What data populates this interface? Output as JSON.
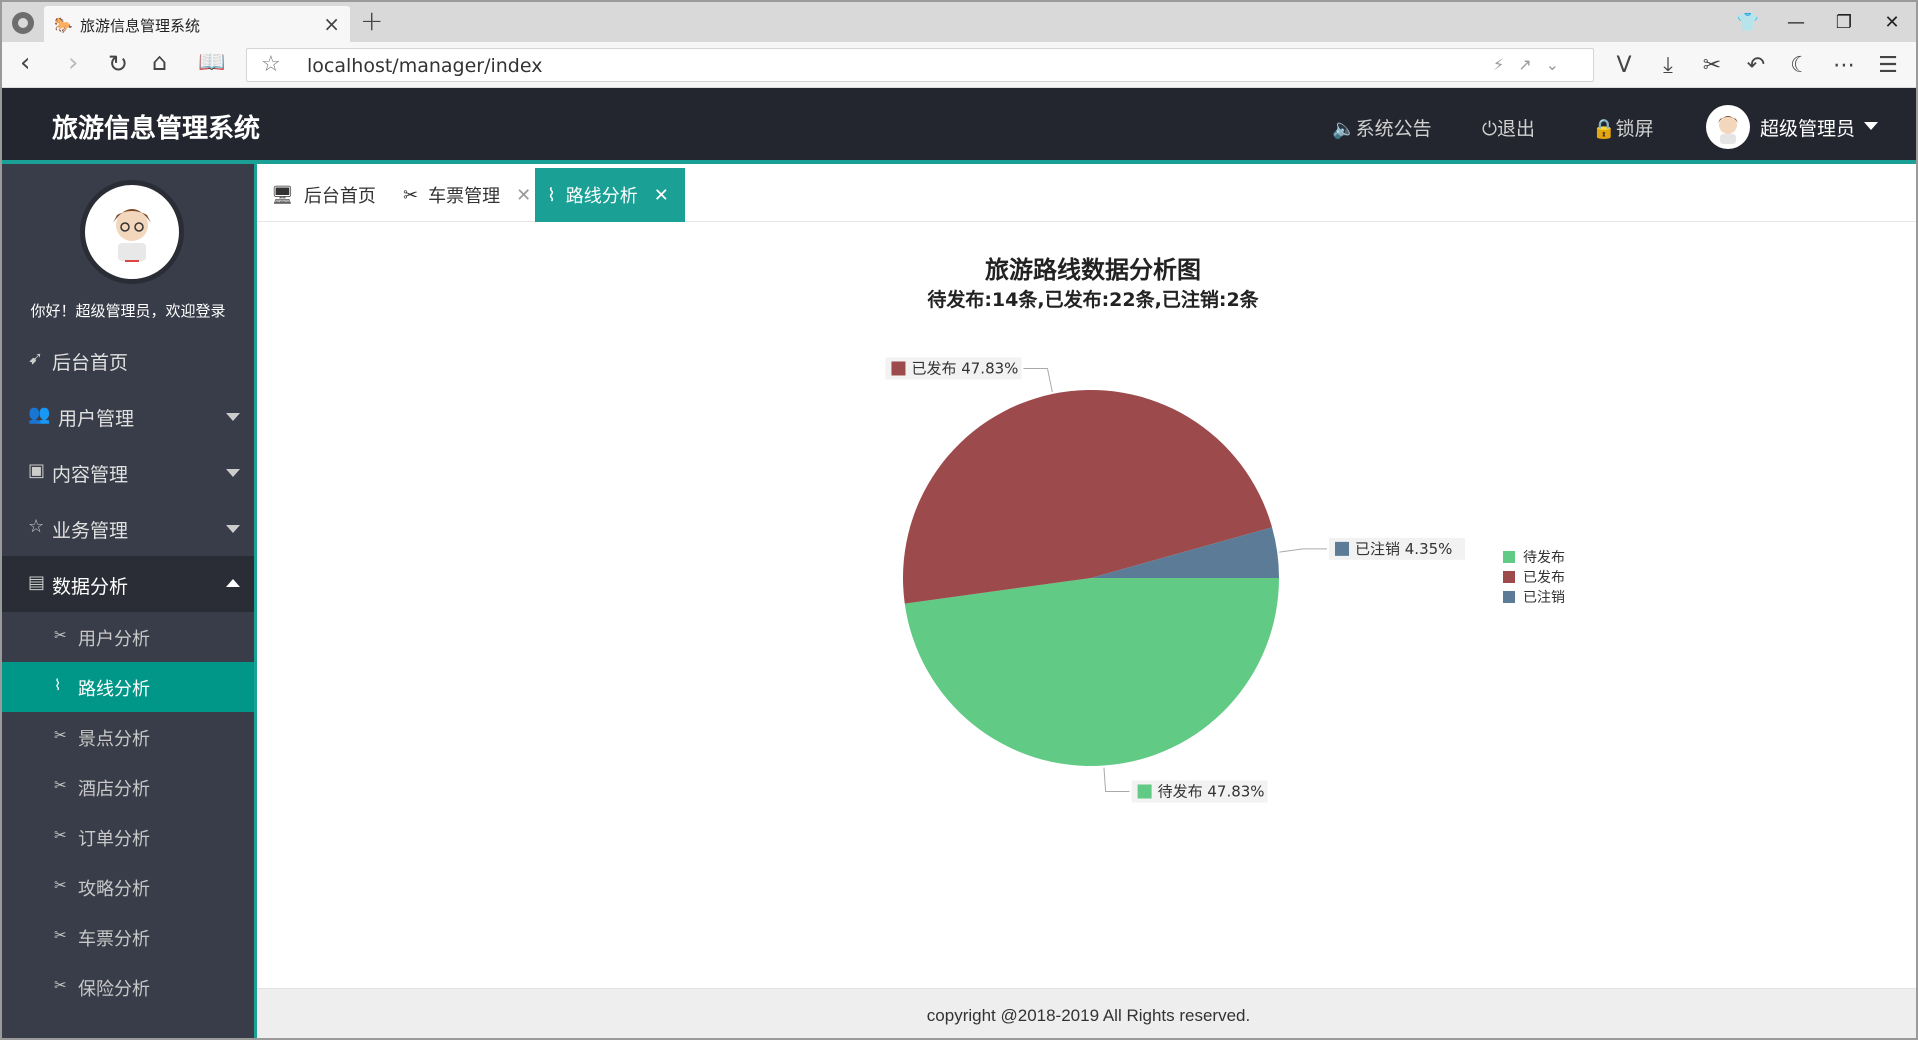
{
  "browser": {
    "tab_title": "旅游信息管理系统",
    "url": "localhost/manager/index",
    "favicon": "horse-icon",
    "new_tab": "+"
  },
  "header": {
    "title": "旅游信息管理系统",
    "notice": "系统公告",
    "logout": "退出",
    "lock": "锁屏",
    "user": "超级管理员"
  },
  "sidebar": {
    "greeting": "你好！超级管理员，欢迎登录",
    "items": [
      {
        "label": "后台首页",
        "icon": "paper-plane-icon"
      },
      {
        "label": "用户管理",
        "icon": "users-icon"
      },
      {
        "label": "内容管理",
        "icon": "image-icon"
      },
      {
        "label": "业务管理",
        "icon": "star-icon"
      },
      {
        "label": "数据分析",
        "icon": "chart-icon"
      }
    ],
    "sub_items": [
      {
        "label": "用户分析"
      },
      {
        "label": "路线分析"
      },
      {
        "label": "景点分析"
      },
      {
        "label": "酒店分析"
      },
      {
        "label": "订单分析"
      },
      {
        "label": "攻略分析"
      },
      {
        "label": "车票分析"
      },
      {
        "label": "保险分析"
      }
    ]
  },
  "tabs": [
    {
      "label": "后台首页",
      "icon": "monitor-icon"
    },
    {
      "label": "车票管理",
      "icon": "tools-icon"
    },
    {
      "label": "路线分析",
      "icon": "pulse-icon"
    }
  ],
  "chart_data": {
    "type": "pie",
    "title": "旅游路线数据分析图",
    "subtitle": "待发布:14条,已发布:22条,已注销:2条",
    "categories": [
      "待发布",
      "已发布",
      "已注销"
    ],
    "values": [
      22,
      22,
      2
    ],
    "percent_labels": [
      "待发布 47.83%",
      "已发布 47.83%",
      "已注销 4.35%"
    ],
    "colors": [
      "#61ca84",
      "#9c4a4b",
      "#5b7b96"
    ],
    "legend_position": "right"
  },
  "footer": {
    "copyright": "copyright @2018-2019 All Rights reserved."
  }
}
